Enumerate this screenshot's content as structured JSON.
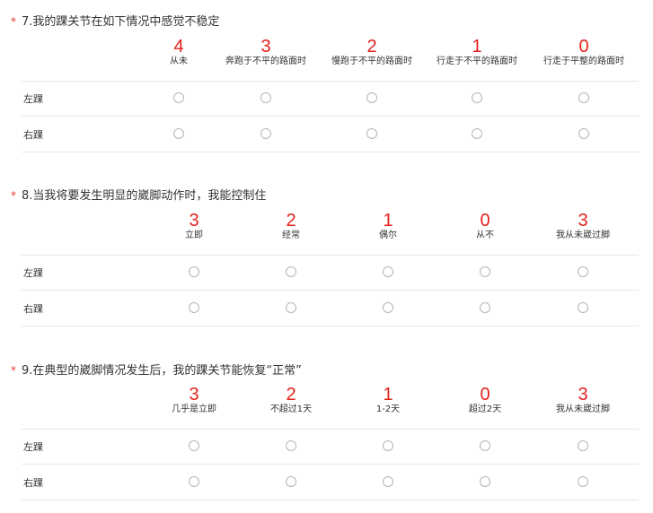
{
  "questions": [
    {
      "title": "7.我的踝关节在如下情况中感觉不稳定",
      "columns": [
        {
          "score": "4",
          "label": "从未"
        },
        {
          "score": "3",
          "label": "奔跑于不平的路面时"
        },
        {
          "score": "2",
          "label": "慢跑于不平的路面时"
        },
        {
          "score": "1",
          "label": "行走于不平的路面时"
        },
        {
          "score": "0",
          "label": "行走于平整的路面时"
        }
      ],
      "rows": [
        "左踝",
        "右踝"
      ]
    },
    {
      "title": "8.当我将要发生明显的崴脚动作时，我能控制住",
      "columns": [
        {
          "score": "3",
          "label": "立即"
        },
        {
          "score": "2",
          "label": "经常"
        },
        {
          "score": "1",
          "label": "偶尔"
        },
        {
          "score": "0",
          "label": "从不"
        },
        {
          "score": "3",
          "label": "我从未崴过脚"
        }
      ],
      "rows": [
        "左踝",
        "右踝"
      ]
    },
    {
      "title": "9.在典型的崴脚情况发生后，我的踝关节能恢复“正常”",
      "columns": [
        {
          "score": "3",
          "label": "几乎是立即"
        },
        {
          "score": "2",
          "label": "不超过1天"
        },
        {
          "score": "1",
          "label": "1-2天"
        },
        {
          "score": "0",
          "label": "超过2天"
        },
        {
          "score": "3",
          "label": "我从未崴过脚"
        }
      ],
      "rows": [
        "左踝",
        "右踝"
      ]
    }
  ],
  "required_marker": "*",
  "colors": {
    "required": "#e5352d",
    "score": "#e3211c",
    "divider": "#e6e6e6",
    "radio_border": "#b5b5b5"
  }
}
